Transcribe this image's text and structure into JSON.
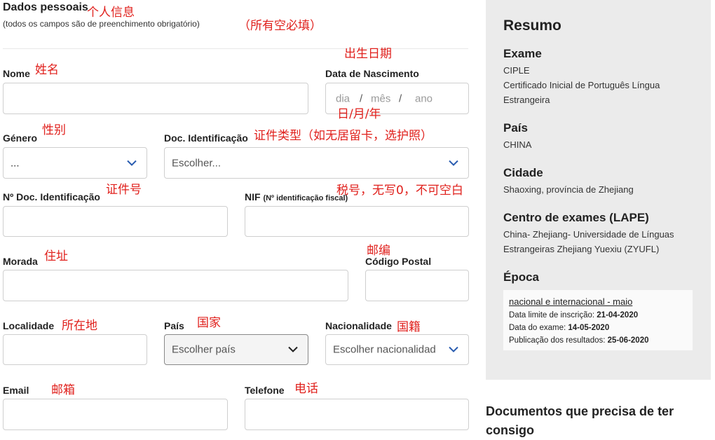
{
  "form": {
    "title": "Dados pessoais",
    "title_note": "个人信息",
    "subtitle": "(todos os campos são de preenchimento obrigatório)",
    "subtitle_note": "（所有空必填）",
    "fields": {
      "nome": {
        "label": "Nome",
        "note": "姓名"
      },
      "nascimento": {
        "label": "Data de Nascimento",
        "note": "出生日期",
        "placeholder_day": "dia",
        "sep1": "/",
        "placeholder_month": "mês",
        "sep2": "/",
        "placeholder_year": "ano",
        "format_note": "日/月/年"
      },
      "genero": {
        "label": "Género",
        "note": "性别",
        "value": "..."
      },
      "doc": {
        "label": "Doc. Identificação",
        "note": "证件类型（如无居留卡，选护照）",
        "value": "Escolher..."
      },
      "doc_num": {
        "label": "Nº Doc. Identificação",
        "note": "证件号"
      },
      "nif": {
        "label": "NIF",
        "label_small": "(Nº identificação fiscal)",
        "note": "税号，无写0，不可空白"
      },
      "morada": {
        "label": "Morada",
        "note": "住址"
      },
      "postal": {
        "label": "Código Postal",
        "note": "邮编"
      },
      "localidade": {
        "label": "Localidade",
        "note": "所在地"
      },
      "pais": {
        "label": "País",
        "note": "国家",
        "value": "Escolher país"
      },
      "nacionalidade": {
        "label": "Nacionalidade",
        "note": "国籍",
        "value": "Escolher nacionalidad"
      },
      "email": {
        "label": "Email",
        "note": "邮箱"
      },
      "telefone": {
        "label": "Telefone",
        "note": "电话"
      }
    }
  },
  "resumo": {
    "title": "Resumo",
    "exame": {
      "heading": "Exame",
      "line1": "CIPLE",
      "line2": "Certificado Inicial de Português Língua",
      "line3": "Estrangeira"
    },
    "pais": {
      "heading": "País",
      "value": "CHINA"
    },
    "cidade": {
      "heading": "Cidade",
      "value": "Shaoxing, província de Zhejiang"
    },
    "centro": {
      "heading": "Centro de exames (LAPE)",
      "line1": "China- Zhejiang- Universidade de Línguas",
      "line2": "Estrangeiras Zhejiang Yuexiu (ZYUFL)"
    },
    "epoca": {
      "heading": "Época",
      "link": "nacional e internacional - maio",
      "limite_label": "Data limite de inscrição:",
      "limite_value": "21-04-2020",
      "exame_label": "Data do exame:",
      "exame_value": "14-05-2020",
      "pub_label": "Publicação dos resultados:",
      "pub_value": "25-06-2020"
    }
  },
  "documentos": {
    "title": "Documentos que precisa de ter consigo"
  },
  "colors": {
    "annotation": "#e0201c",
    "chevron_blue": "#2a5db0",
    "panel_bg": "#ebebeb"
  }
}
